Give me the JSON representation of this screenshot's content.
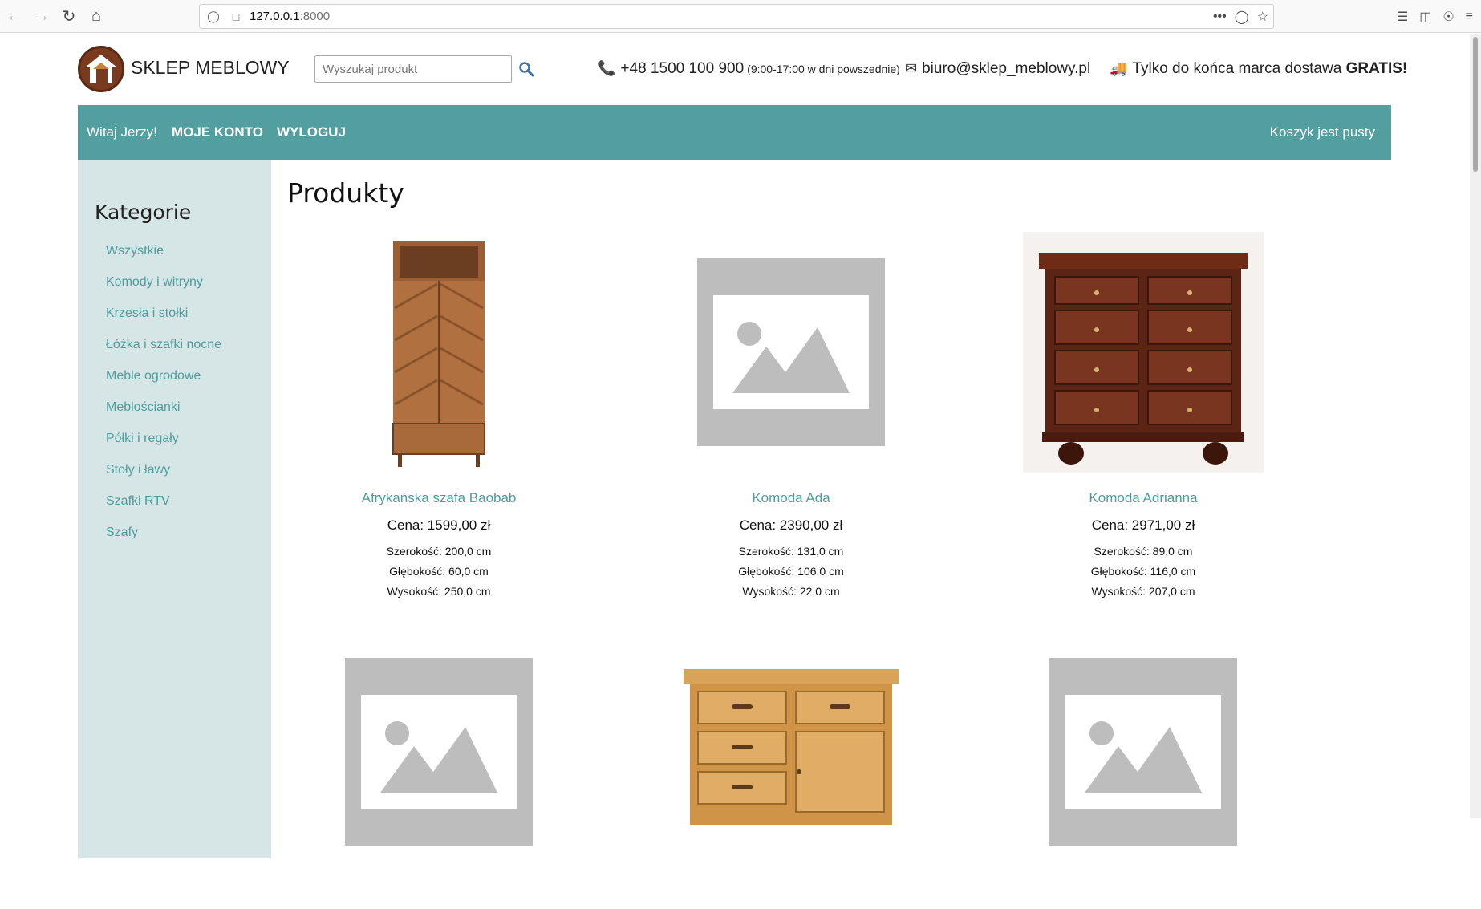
{
  "browser": {
    "url_host": "127.0.0.1",
    "url_port": ":8000"
  },
  "header": {
    "brand": "SKLEP MEBLOWY",
    "search_placeholder": "Wyszukaj produkt",
    "phone": "+48 1500 100 900",
    "phone_hours": "(9:00-17:00 w dni powszednie)",
    "email": "biuro@sklep_meblowy.pl",
    "delivery_text": "Tylko do końca marca dostawa",
    "delivery_bold": "GRATIS!"
  },
  "navbar": {
    "greeting": "Witaj Jerzy!",
    "account": "MOJE KONTO",
    "logout": "WYLOGUJ",
    "cart": "Koszyk jest pusty"
  },
  "sidebar": {
    "title": "Kategorie",
    "items": [
      "Wszystkie",
      "Komody i witryny",
      "Krzesła i stołki",
      "Łóżka i szafki nocne",
      "Meble ogrodowe",
      "Meblościanki",
      "Półki i regały",
      "Stoły i ławy",
      "Szafki RTV",
      "Szafy"
    ]
  },
  "main": {
    "title": "Produkty",
    "products": [
      {
        "name": "Afrykańska szafa Baobab",
        "price": "Cena: 1599,00 zł",
        "width": "Szerokość: 200,0 cm",
        "depth": "Głębokość: 60,0 cm",
        "height": "Wysokość: 250,0 cm"
      },
      {
        "name": "Komoda Ada",
        "price": "Cena: 2390,00 zł",
        "width": "Szerokość: 131,0 cm",
        "depth": "Głębokość: 106,0 cm",
        "height": "Wysokość: 22,0 cm"
      },
      {
        "name": "Komoda Adrianna",
        "price": "Cena: 2971,00 zł",
        "width": "Szerokość: 89,0 cm",
        "depth": "Głębokość: 116,0 cm",
        "height": "Wysokość: 207,0 cm"
      }
    ]
  },
  "colors": {
    "accent": "#539e9f",
    "sidebar_bg": "#d6e6e6",
    "link": "#4f9c9d",
    "placeholder_gray": "#bdbdbd"
  }
}
